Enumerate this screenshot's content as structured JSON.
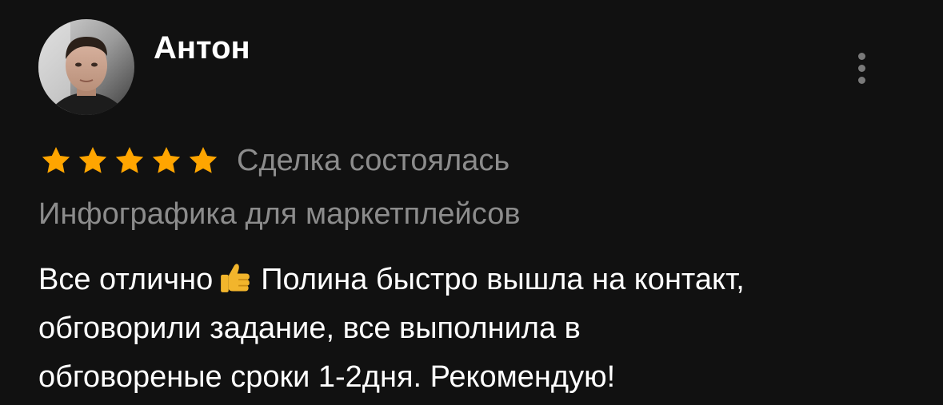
{
  "author": {
    "name": "Антон",
    "avatar_icon": "user-photo"
  },
  "menu": {
    "icon": "more-vertical-icon"
  },
  "rating": {
    "stars": 5,
    "max": 5,
    "star_color": "#ffa500",
    "deal_status": "Сделка состоялась"
  },
  "category": "Инфографика для маркетплейсов",
  "review": {
    "line1_before": "Все отлично",
    "emoji": "thumbs-up-icon",
    "line1_after": "Полина быстро вышла на контакт,",
    "line2": "обговорили задание, все выполнила в",
    "line3": "обговореные сроки 1-2дня. Рекомендую!"
  },
  "colors": {
    "background": "#111111",
    "primary_text": "#ffffff",
    "secondary_text": "#8c8c8c"
  }
}
